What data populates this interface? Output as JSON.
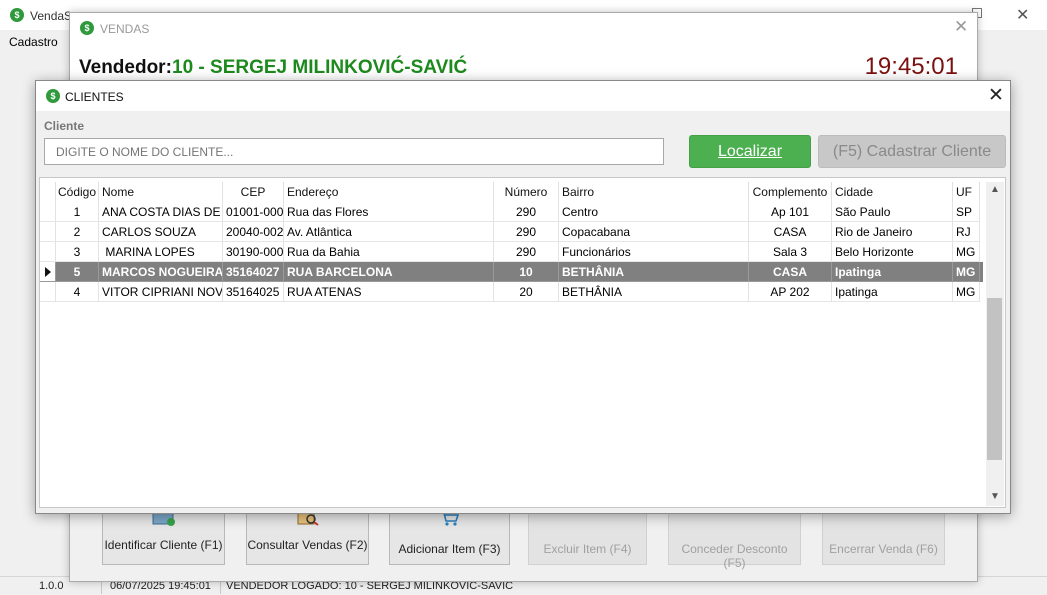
{
  "main": {
    "title": "VendaS",
    "menu": [
      "Cadastro"
    ],
    "status": {
      "version": "1.0.0",
      "datetime": "06/07/2025 19:45:01",
      "logged_user": "VENDEDOR LOGADO:  10 - SERGEJ MILINKOVIĆ-SAVIĆ"
    }
  },
  "vendas": {
    "title": "VENDAS",
    "vendedor_label": "Vendedor:",
    "vendedor_name": "10 - SERGEJ MILINKOVIĆ-SAVIĆ",
    "clock": "19:45:01",
    "actions": [
      {
        "label": "Identificar Cliente (F1)",
        "enabled": true
      },
      {
        "label": "Consultar Vendas (F2)",
        "enabled": true
      },
      {
        "label": "Adicionar Item (F3)",
        "enabled": true
      },
      {
        "label": "Excluir Item (F4)",
        "enabled": false
      },
      {
        "label": "Conceder Desconto (F5)",
        "enabled": false
      },
      {
        "label": "Encerrar Venda (F6)",
        "enabled": false
      }
    ]
  },
  "clientes": {
    "title": "CLIENTES",
    "field_label": "Cliente",
    "placeholder": "DIGITE O NOME DO CLIENTE...",
    "localizar_label": "Localizar",
    "cadastrar_label": "(F5) Cadastrar Cliente",
    "columns": [
      "Código",
      "Nome",
      "CEP",
      "Endereço",
      "Número",
      "Bairro",
      "Complemento",
      "Cidade",
      "UF"
    ],
    "rows": [
      [
        "1",
        "ANA COSTA DIAS DE S",
        "01001-000",
        "Rua das Flores",
        "290",
        "Centro",
        "Ap 101",
        "São Paulo",
        "SP"
      ],
      [
        "2",
        "CARLOS SOUZA",
        "20040-002",
        "Av. Atlântica",
        "290",
        "Copacabana",
        "CASA",
        "Rio de Janeiro",
        "RJ"
      ],
      [
        "3",
        " MARINA LOPES",
        "30190-000",
        "Rua da Bahia",
        "290",
        "Funcionários",
        "Sala 3",
        "Belo Horizonte",
        "MG"
      ],
      [
        "5",
        "MARCOS NOGUEIRA",
        "35164027",
        "RUA BARCELONA",
        "10",
        "BETHÂNIA",
        "CASA",
        "Ipatinga",
        "MG"
      ],
      [
        "4",
        "VITOR CIPRIANI NOVA",
        "35164025",
        "RUA ATENAS",
        "20",
        "BETHÂNIA",
        "AP 202",
        "Ipatinga",
        "MG"
      ]
    ],
    "selected_row": 3
  },
  "colors": {
    "accent_green": "#4caf50",
    "vendedor_green": "#1d8a1d",
    "clock_red": "#7a1010",
    "selected_row": "#808080"
  }
}
